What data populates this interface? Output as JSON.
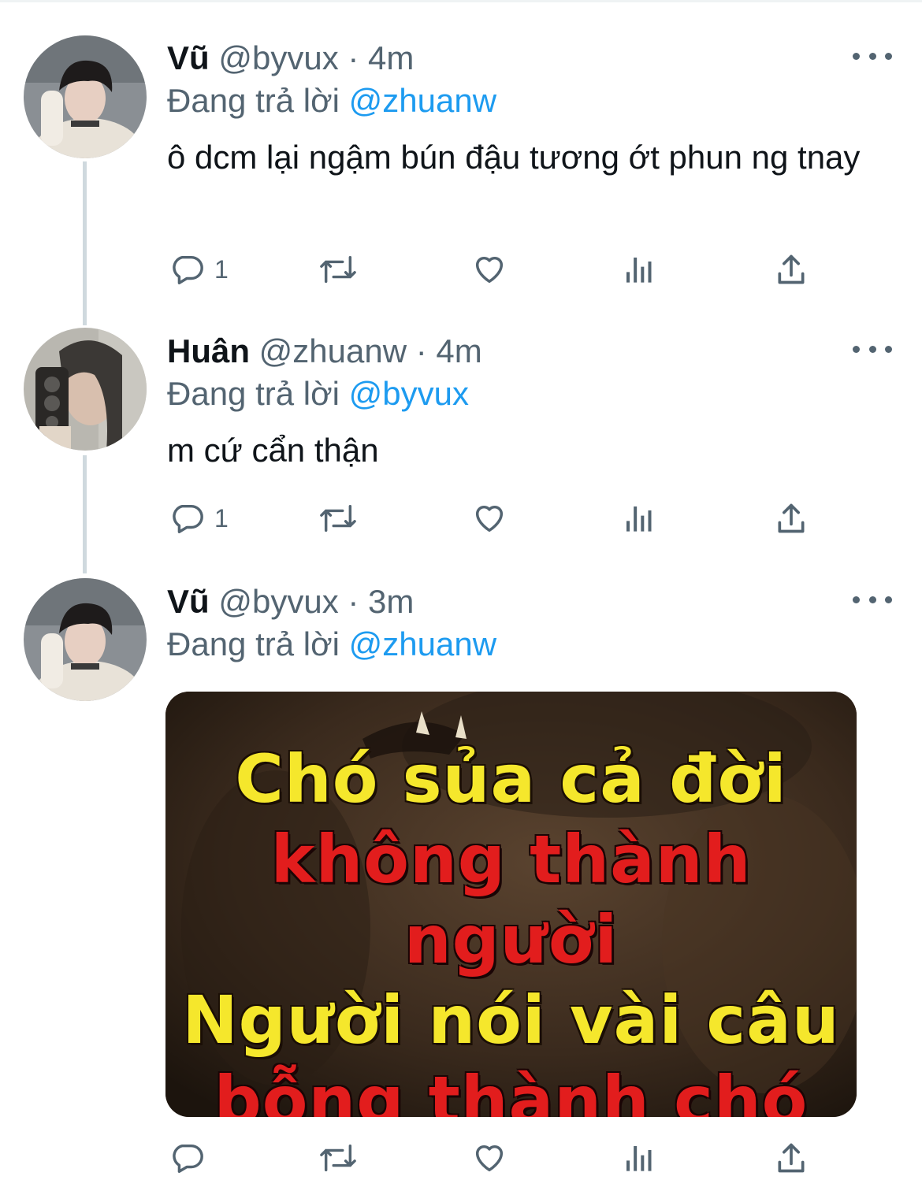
{
  "tweets": [
    {
      "name": "Vũ",
      "meta": "@byvux · 4m",
      "reply_prefix": "Đang trả lời",
      "reply_to": "@zhuanw",
      "text": "ô dcm lại ngậm bún đậu tương ớt phun ng tnay",
      "reply_count": "1"
    },
    {
      "name": "Huân",
      "meta": "@zhuanw · 4m",
      "reply_prefix": "Đang trả lời",
      "reply_to": "@byvux",
      "text": "m cứ cẩn thận",
      "reply_count": "1"
    },
    {
      "name": "Vũ",
      "meta": "@byvux · 3m",
      "reply_prefix": "Đang trả lời",
      "reply_to": "@zhuanw",
      "media_text": [
        "Chó sủa cả đời",
        "không thành người",
        "Người nói vài câu",
        "bỗng thành chó"
      ]
    }
  ],
  "icons": {
    "reply": "comment-bubble-icon",
    "retweet": "retweet-icon",
    "like": "heart-icon",
    "views": "analytics-icon",
    "share": "share-icon",
    "more": "more-dots-icon"
  },
  "colors": {
    "link": "#1d9bf0",
    "secondary": "#536471",
    "meme_yellow": "#f5e72c",
    "meme_red": "#e21d1d"
  }
}
